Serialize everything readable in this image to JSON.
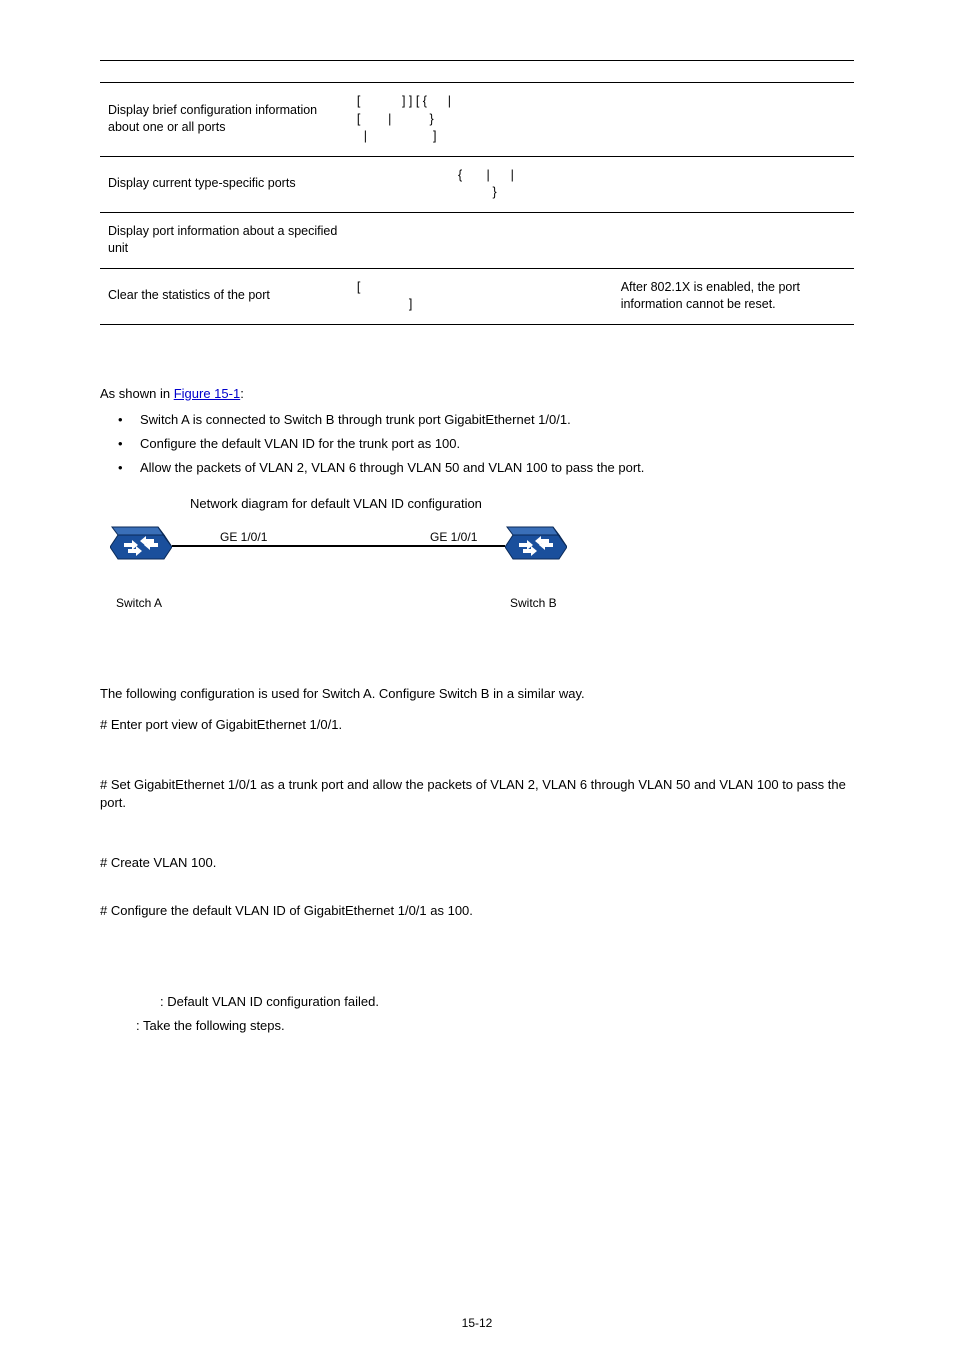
{
  "table": {
    "rows": [
      {
        "desc": "Display brief configuration information about one or all ports",
        "cmd": "[            ] ] [ {      |\n[        |           }\n  |                   ]",
        "note": ""
      },
      {
        "desc": "Display current type-specific ports",
        "cmd": "   {       |      |\n        }",
        "note": ""
      },
      {
        "desc": "Display port information about a specified unit",
        "cmd": "",
        "note": ""
      },
      {
        "desc": "Clear the statistics of the port",
        "cmd": "[\n               ]",
        "note": "After 802.1X is enabled, the port information cannot be reset."
      }
    ]
  },
  "intro_prefix": "As shown in ",
  "intro_link": "Figure 15-1",
  "intro_suffix": ":",
  "bullets": [
    "Switch A is connected to Switch B through trunk port GigabitEthernet 1/0/1.",
    "Configure the default VLAN ID for the trunk port as 100.",
    "Allow the packets of VLAN 2, VLAN 6 through VLAN 50 and VLAN 100 to pass the port."
  ],
  "fig_caption": "Network diagram for default VLAN ID configuration",
  "diagram": {
    "port_a": "GE 1/0/1",
    "port_b": "GE 1/0/1",
    "switch_a": "Switch A",
    "switch_b": "Switch B"
  },
  "config_intro": "The following configuration is used for Switch A. Configure Switch B in a similar way.",
  "step1": "# Enter port view of GigabitEthernet 1/0/1.",
  "step2": "# Set GigabitEthernet 1/0/1 as a trunk port and allow the packets of VLAN 2, VLAN 6 through VLAN 50 and VLAN 100 to pass the port.",
  "step3": "# Create VLAN 100.",
  "step4": "# Configure the default VLAN ID of GigabitEthernet 1/0/1 as 100.",
  "trouble1": ": Default VLAN ID configuration failed.",
  "trouble2": ": Take the following steps.",
  "page_num": "15-12"
}
